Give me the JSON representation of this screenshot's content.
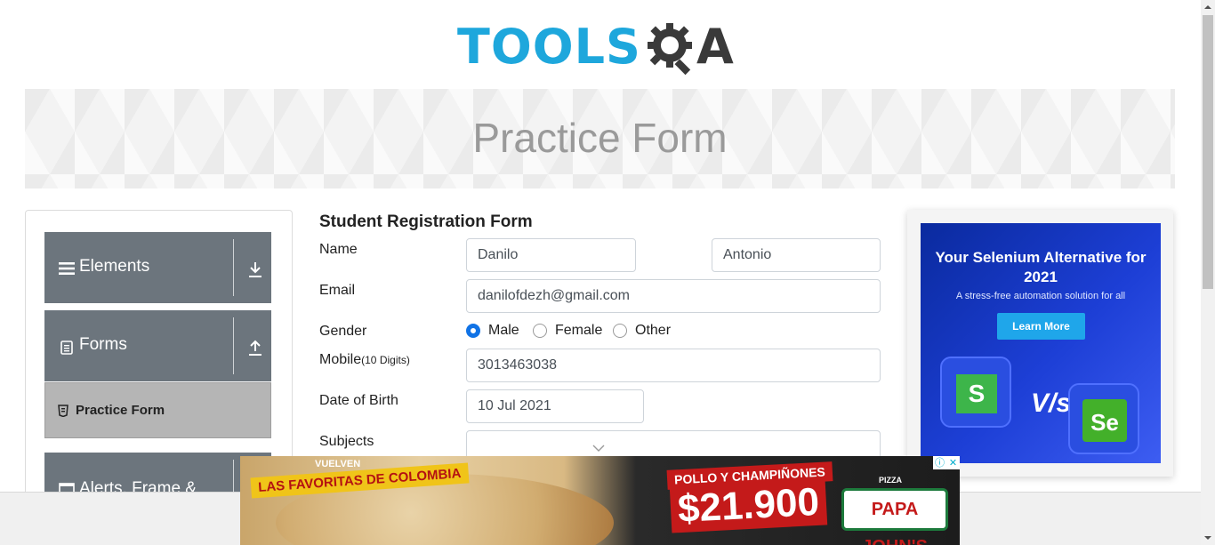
{
  "header": {
    "logo_text": "TOOLS",
    "logo_suffix": "A",
    "logo_icon": "gear-magnifier-icon"
  },
  "banner": {
    "title": "Practice Form"
  },
  "sidebar": {
    "groups": [
      {
        "label": "Elements",
        "icon": "menu-lines-icon",
        "arrow": "download-arrow-icon"
      },
      {
        "label": "Forms",
        "icon": "document-icon",
        "arrow": "upload-arrow-icon"
      },
      {
        "label": "Alerts, Frame &",
        "icon": "window-icon"
      }
    ],
    "active_item": {
      "label": "Practice Form",
      "icon": "html5-shield-icon"
    }
  },
  "form": {
    "title": "Student Registration Form",
    "name_label": "Name",
    "first_name_value": "Danilo",
    "last_name_value": "Antonio",
    "email_label": "Email",
    "email_value": "danilofdezh@gmail.com",
    "gender_label": "Gender",
    "gender_options": [
      "Male",
      "Female",
      "Other"
    ],
    "gender_selected": "Male",
    "mobile_label": "Mobile",
    "mobile_hint": "(10 Digits)",
    "mobile_value": "3013463038",
    "dob_label": "Date of Birth",
    "dob_value": "10 Jul 2021",
    "subjects_label": "Subjects",
    "subjects_value": ""
  },
  "right_ad": {
    "headline": "Your Selenium Alternative for 2021",
    "subline": "A stress-free automation solution for all",
    "button": "Learn More",
    "vs": "V/s",
    "logo_left": "S",
    "logo_right": "Se"
  },
  "bottom_ad": {
    "tag_small": "VUELVEN",
    "tag_main": "LAS FAVORITAS DE COLOMBIA",
    "product": "POLLO Y CHAMPIÑONES",
    "price": "$21.900",
    "brand": "PAPA JOHN'S",
    "brand_small": "PIZZA",
    "info": "ⓘ",
    "close": "✕"
  },
  "colors": {
    "brand_blue": "#1ea7dc",
    "sidebar_group": "#6c757d",
    "sidebar_active": "#b5b5b5",
    "radio_checked": "#1173e6",
    "ad_blue": "#1d3fd6",
    "ad_button": "#1fa6ea"
  }
}
